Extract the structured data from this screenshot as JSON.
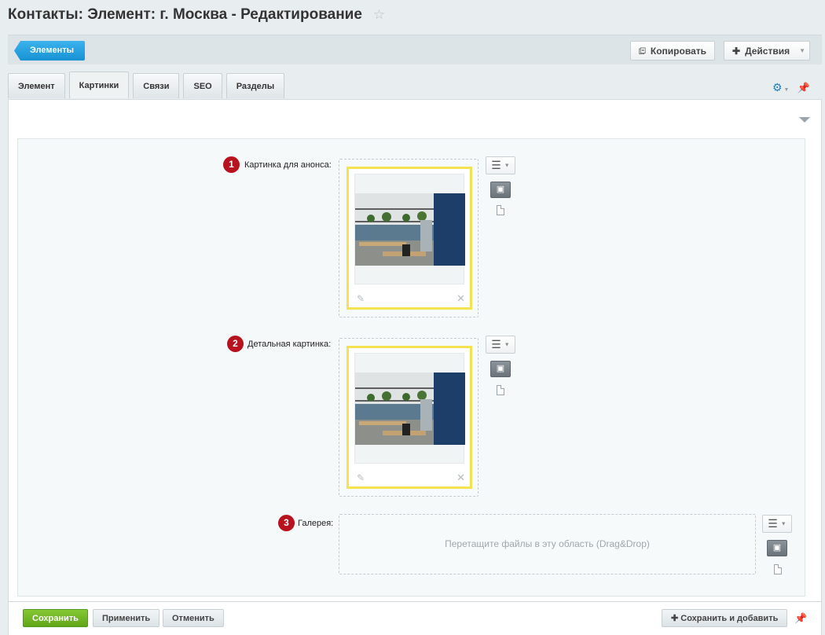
{
  "page": {
    "title": "Контакты: Элемент: г. Москва - Редактирование"
  },
  "toolbar": {
    "back_label": "Элементы",
    "copy_label": "Копировать",
    "actions_label": "Действия"
  },
  "tabs": [
    {
      "label": "Элемент",
      "active": false
    },
    {
      "label": "Картинки",
      "active": true
    },
    {
      "label": "Связи",
      "active": false
    },
    {
      "label": "SEO",
      "active": false
    },
    {
      "label": "Разделы",
      "active": false
    }
  ],
  "fields": [
    {
      "badge": "1",
      "label": "Картинка для анонса:"
    },
    {
      "badge": "2",
      "label": "Детальная картинка:"
    },
    {
      "badge": "3",
      "label": "Галерея:"
    }
  ],
  "gallery": {
    "drop_text": "Перетащите файлы в эту область (Drag&Drop)"
  },
  "footer": {
    "save_label": "Сохранить",
    "apply_label": "Применить",
    "cancel_label": "Отменить",
    "save_add_label": "Сохранить и добавить"
  },
  "colors": {
    "accent_blue": "#1892d4",
    "save_green": "#6fb423",
    "badge_red": "#b8121e",
    "card_border_yellow": "#f5e251"
  },
  "icons": [
    "star-icon",
    "copy-icon",
    "plus-icon",
    "gear-icon",
    "pin-icon",
    "menu-icon",
    "image-icon",
    "file-icon",
    "pencil-icon",
    "close-icon"
  ]
}
